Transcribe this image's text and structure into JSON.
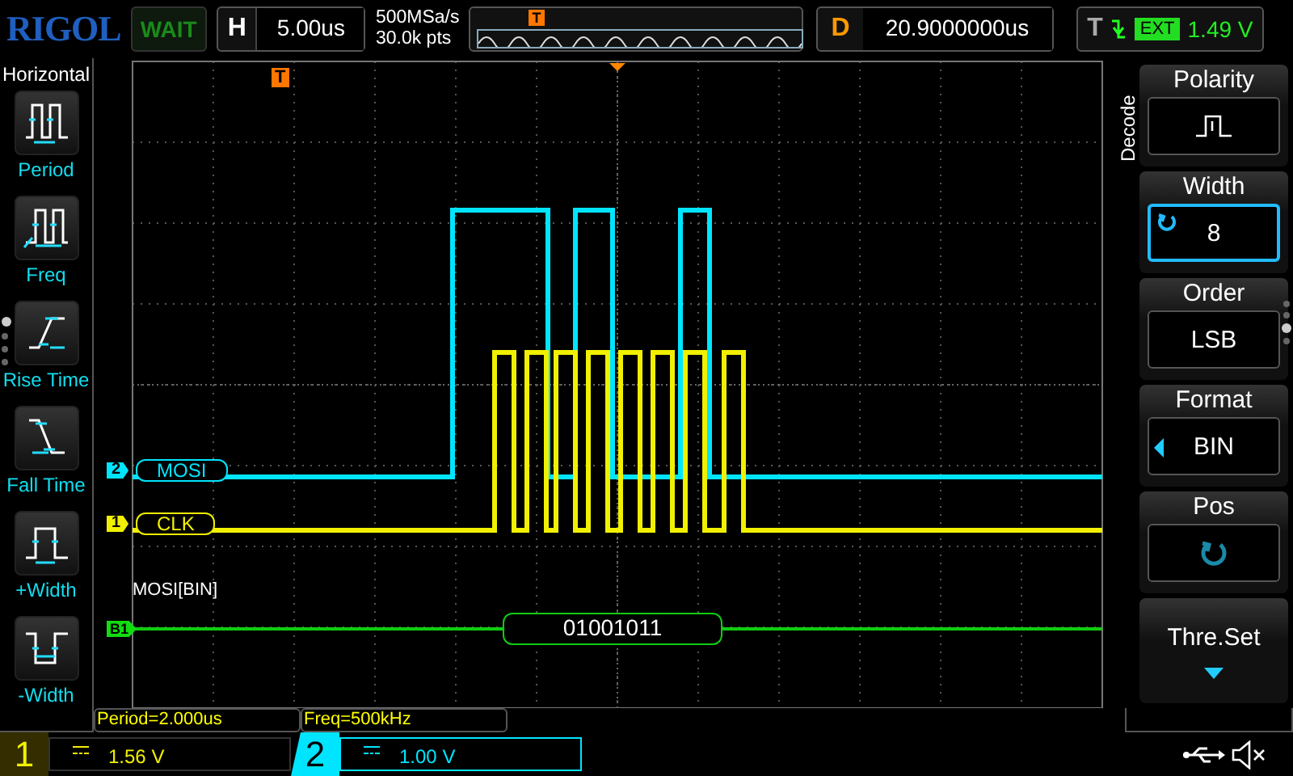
{
  "brand": "RIGOL",
  "run_status": "WAIT",
  "horizontal": {
    "label": "H",
    "value": "5.00us"
  },
  "acquisition": {
    "sample_rate": "500MSa/s",
    "memory_depth": "30.0k pts",
    "marker": "T"
  },
  "delay": {
    "label": "D",
    "value": "20.9000000us"
  },
  "trigger": {
    "label": "T",
    "source": "EXT",
    "level": "1.49 V"
  },
  "left_menu": {
    "title": "Horizontal",
    "items": [
      {
        "label": "Period",
        "kind": "period"
      },
      {
        "label": "Freq",
        "kind": "freq"
      },
      {
        "label": "Rise Time",
        "kind": "rise"
      },
      {
        "label": "Fall Time",
        "kind": "fall"
      },
      {
        "label": "+Width",
        "kind": "pwidth"
      },
      {
        "label": "-Width",
        "kind": "nwidth"
      }
    ],
    "pages": [
      {
        "selected": true
      },
      {
        "selected": false
      },
      {
        "selected": false
      },
      {
        "selected": false
      }
    ]
  },
  "display": {
    "trigger_marker": "T",
    "traces": [
      {
        "marker": "2",
        "label": "MOSI",
        "color": "#00e5ff"
      },
      {
        "marker": "1",
        "label": "CLK",
        "color": "#f0f000"
      }
    ],
    "decode": {
      "title": "MOSI[BIN]",
      "marker": "B1",
      "value": "01001011"
    }
  },
  "measurements": [
    "Period=2.000us",
    "Freq=500kHz"
  ],
  "right_menu": {
    "title": "Decode",
    "items": [
      {
        "label": "Polarity",
        "kind": "polarity",
        "selected": false
      },
      {
        "label": "Width",
        "kind": "value",
        "value": "8",
        "selected": true
      },
      {
        "label": "Order",
        "kind": "value",
        "value": "LSB",
        "selected": false
      },
      {
        "label": "Format",
        "kind": "value",
        "value": "BIN",
        "selected": false
      },
      {
        "label": "Pos",
        "kind": "knob",
        "selected": false
      },
      {
        "label": "Thre.Set",
        "kind": "submenu",
        "selected": false
      }
    ],
    "pages": [
      {
        "selected": false
      },
      {
        "selected": false
      },
      {
        "selected": true
      },
      {
        "selected": false
      }
    ]
  },
  "channels": [
    {
      "number": "1",
      "scale": "1.56 V",
      "color": "#f0f000",
      "selected": false
    },
    {
      "number": "2",
      "scale": "1.00 V",
      "color": "#00e5ff",
      "selected": true
    }
  ]
}
